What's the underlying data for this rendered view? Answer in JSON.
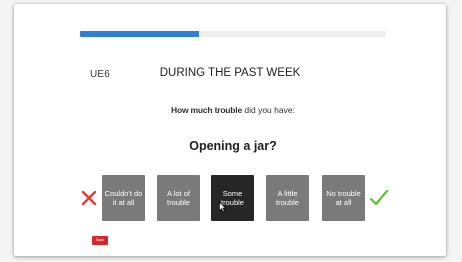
{
  "progress": {
    "fraction": 0.39,
    "color": "#2f7fd8"
  },
  "question": {
    "code": "UE6",
    "period_title": "DURING THE PAST WEEK",
    "prompt_bold": "How much trouble",
    "prompt_rest": " did you have:",
    "activity": "Opening a jar?"
  },
  "answers": [
    {
      "label": "Couldn't do it at all",
      "selected": false
    },
    {
      "label": "A lot of trouble",
      "selected": false
    },
    {
      "label": "Some trouble",
      "selected": true
    },
    {
      "label": "A little trouble",
      "selected": false
    },
    {
      "label": "No trouble at all",
      "selected": false
    }
  ],
  "scale_marks": {
    "worst_icon": "red-x-icon",
    "best_icon": "green-check-icon",
    "worst_color": "#e53935",
    "best_color": "#5cc02e"
  },
  "back_button": {
    "label": "Back",
    "color": "#d8262c"
  },
  "colors": {
    "answer_default": "#7a7a7a",
    "answer_selected": "#262626"
  }
}
